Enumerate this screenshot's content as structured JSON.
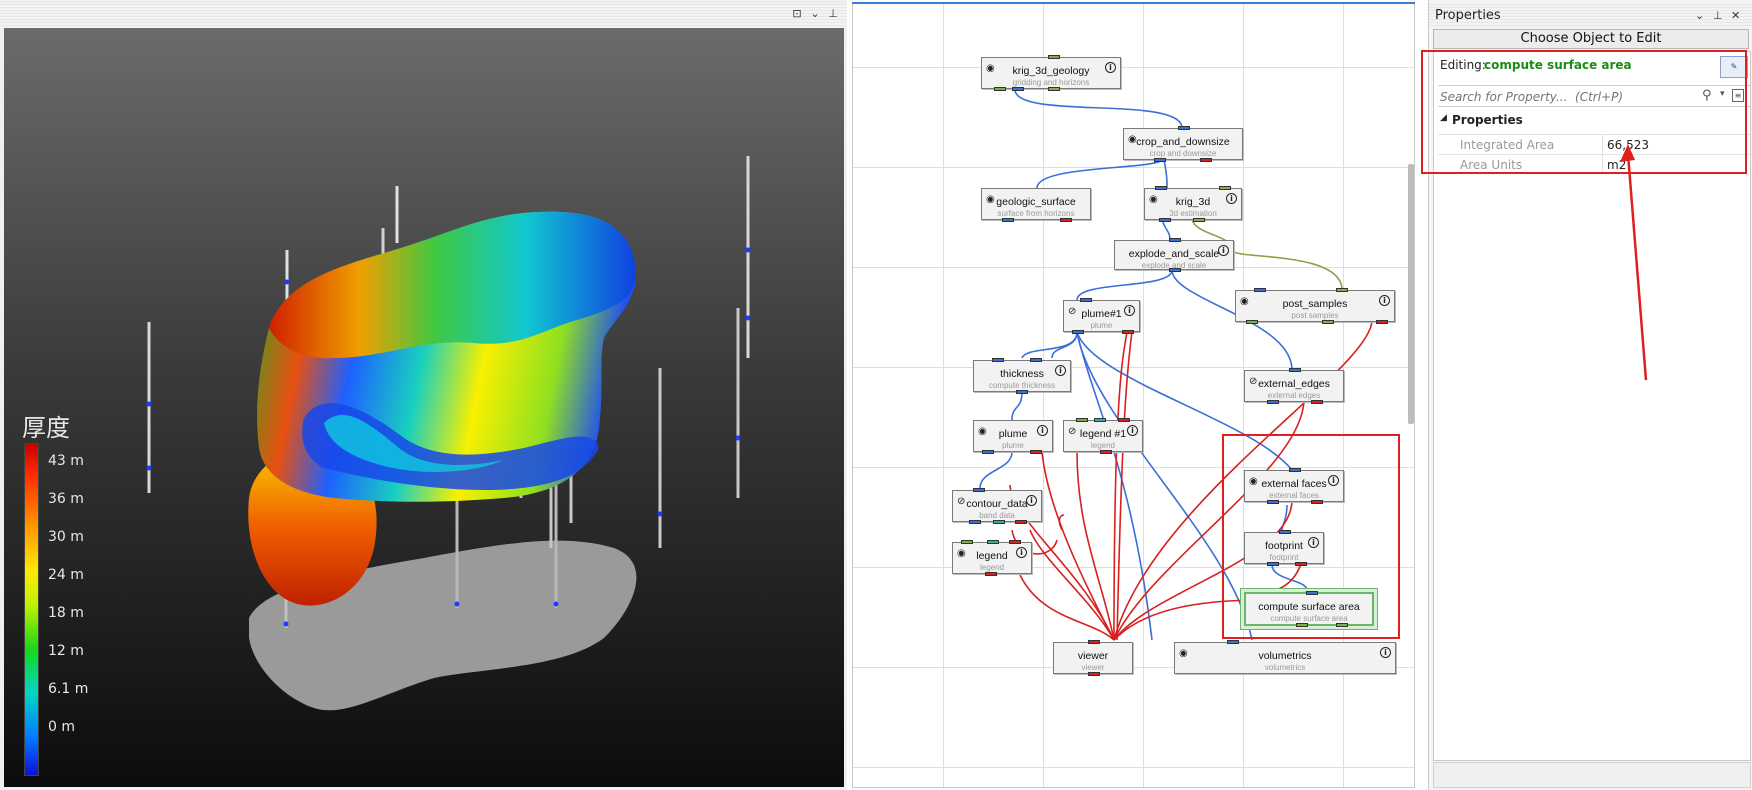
{
  "viewer": {
    "legend_title": "厚度",
    "legend_labels": [
      "43 m",
      "36 m",
      "30 m",
      "24 m",
      "18 m",
      "12 m",
      "6.1 m",
      "0 m"
    ]
  },
  "network": {
    "modules": [
      {
        "id": "krig_3d_geology",
        "name": "krig_3d_geology",
        "sub": "gridding and horizons"
      },
      {
        "id": "crop_and_downsize",
        "name": "crop_and_downsize",
        "sub": "crop and downsize"
      },
      {
        "id": "geologic_surface",
        "name": "geologic_surface",
        "sub": "surface from horizons"
      },
      {
        "id": "krig_3d",
        "name": "krig_3d",
        "sub": "3d estimation"
      },
      {
        "id": "explode_and_scale",
        "name": "explode_and_scale",
        "sub": "explode and scale"
      },
      {
        "id": "post_samples",
        "name": "post_samples",
        "sub": "post samples"
      },
      {
        "id": "plume1",
        "name": "plume#1",
        "sub": "plume"
      },
      {
        "id": "thickness",
        "name": "thickness",
        "sub": "compute thickness"
      },
      {
        "id": "external_edges",
        "name": "external_edges",
        "sub": "external edges"
      },
      {
        "id": "plume",
        "name": "plume",
        "sub": "plume"
      },
      {
        "id": "legend1",
        "name": "legend #1",
        "sub": "legend"
      },
      {
        "id": "external_faces",
        "name": "external faces",
        "sub": "external faces"
      },
      {
        "id": "contour_data",
        "name": "contour_data",
        "sub": "band data"
      },
      {
        "id": "footprint",
        "name": "footprint",
        "sub": "footprint"
      },
      {
        "id": "legend",
        "name": "legend",
        "sub": "legend"
      },
      {
        "id": "compute_surface_area",
        "name": "compute surface area",
        "sub": "compute surface area"
      },
      {
        "id": "viewer",
        "name": "viewer",
        "sub": "viewer"
      },
      {
        "id": "volumetrics",
        "name": "volumetrics",
        "sub": "volumetrics"
      }
    ]
  },
  "properties": {
    "panel_title": "Properties",
    "choose_button": "Choose Object to Edit",
    "editing_label": "Editing:",
    "editing_value": "compute surface area",
    "search_placeholder": "Search for Property...  (Ctrl+P)",
    "section_title": "Properties",
    "rows": [
      {
        "name": "Integrated Area",
        "value": "66,523"
      },
      {
        "name": "Area Units",
        "value": "m2"
      }
    ]
  },
  "colors": {
    "highlight": "#e02020",
    "editing_value": "#1a8a1a",
    "wire_blue": "#3a6fd8",
    "wire_red": "#d82020",
    "wire_olive": "#9a9a4a"
  }
}
